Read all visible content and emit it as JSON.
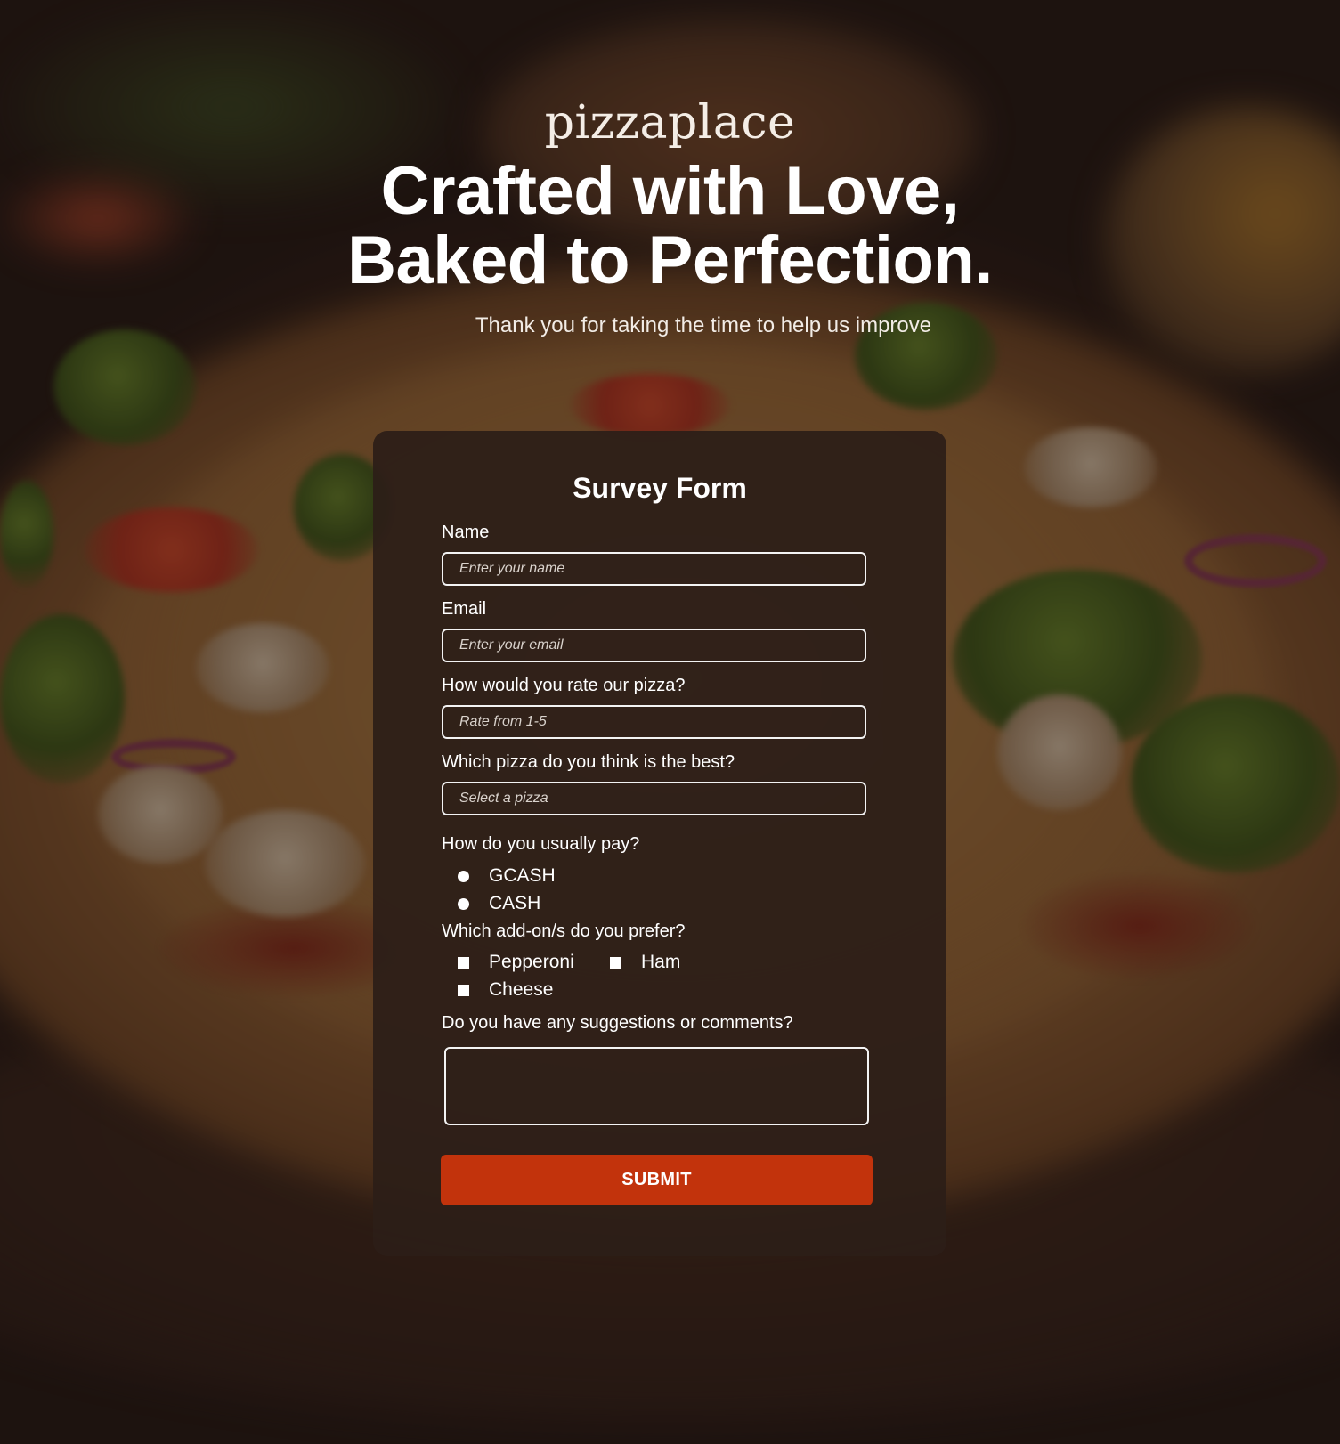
{
  "header": {
    "brand": "pizzaplace",
    "headline_line1": "Crafted with Love,",
    "headline_line2": "Baked to Perfection.",
    "subtitle": "Thank you for taking the time to help us improve"
  },
  "form": {
    "title": "Survey Form",
    "name": {
      "label": "Name",
      "placeholder": "Enter your name"
    },
    "email": {
      "label": "Email",
      "placeholder": "Enter your email"
    },
    "rating": {
      "label": "How would you rate our pizza?",
      "placeholder": "Rate from 1-5"
    },
    "best_pizza": {
      "label": "Which pizza do you think is the best?",
      "placeholder": "Select a pizza"
    },
    "payment": {
      "label": "How do you usually pay?",
      "options": [
        "GCASH",
        "CASH"
      ]
    },
    "addons": {
      "label": "Which add-on/s do you prefer?",
      "options": [
        "Pepperoni",
        "Ham",
        "Cheese"
      ]
    },
    "comments": {
      "label": "Do you have any suggestions or comments?",
      "value": ""
    },
    "submit_label": "SUBMIT"
  },
  "colors": {
    "accent": "#c2330c",
    "card_background": "#2c1e18",
    "text": "#ffffff"
  }
}
